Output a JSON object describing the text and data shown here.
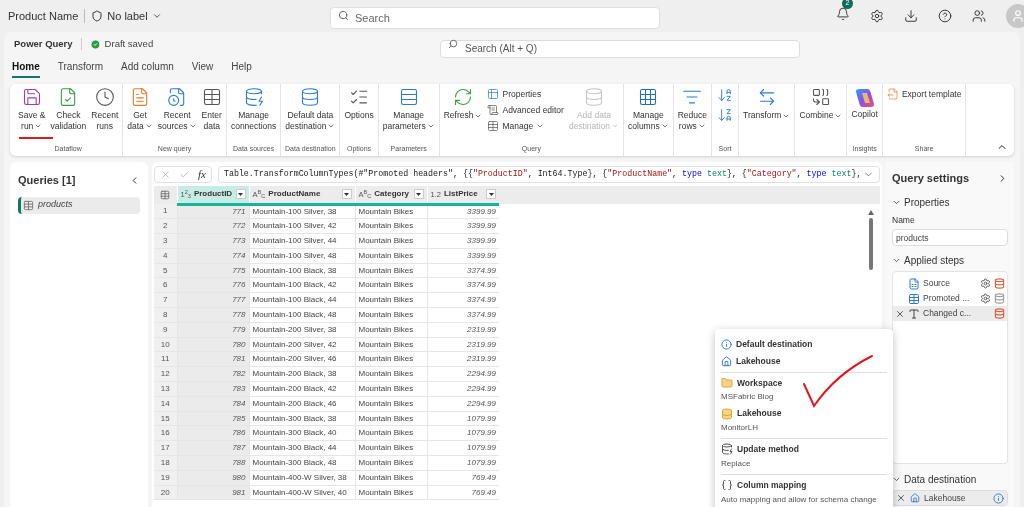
{
  "top_bar": {
    "title": "Product Name",
    "sensitivity": "No label",
    "search": {
      "placeholder": "Search"
    },
    "notification_count": "2"
  },
  "app_bar": {
    "app_name": "Power Query",
    "status": "Draft saved",
    "search": {
      "placeholder": "Search (Alt + Q)"
    }
  },
  "tabs": [
    {
      "label": "Home",
      "selected": true
    },
    {
      "label": "Transform",
      "selected": false
    },
    {
      "label": "Add column",
      "selected": false
    },
    {
      "label": "View",
      "selected": false
    },
    {
      "label": "Help",
      "selected": false
    }
  ],
  "ribbon": {
    "groups": [
      {
        "label": "Dataflow",
        "items": [
          {
            "kind": "large",
            "lines": [
              "Save &",
              "run"
            ],
            "dropdown": true,
            "disabled": false
          },
          {
            "kind": "large",
            "lines": [
              "Check",
              "validation"
            ],
            "dropdown": false,
            "disabled": false
          },
          {
            "kind": "large",
            "lines": [
              "Recent",
              "runs"
            ],
            "dropdown": false,
            "disabled": false
          }
        ]
      },
      {
        "label": "New query",
        "items": [
          {
            "kind": "large",
            "lines": [
              "Get",
              "data"
            ],
            "dropdown": true,
            "disabled": false
          },
          {
            "kind": "large",
            "lines": [
              "Recent",
              "sources"
            ],
            "dropdown": true,
            "disabled": false
          },
          {
            "kind": "large",
            "lines": [
              "Enter",
              "data"
            ],
            "dropdown": false,
            "disabled": false
          }
        ]
      },
      {
        "label": "Data sources",
        "items": [
          {
            "kind": "large",
            "lines": [
              "Manage",
              "connections"
            ],
            "dropdown": false,
            "disabled": false
          }
        ]
      },
      {
        "label": "Data destination",
        "items": [
          {
            "kind": "large",
            "lines": [
              "Default data",
              "destination"
            ],
            "dropdown": true,
            "disabled": false
          }
        ]
      },
      {
        "label": "Options",
        "items": [
          {
            "kind": "large",
            "lines": [
              "Options"
            ],
            "dropdown": false,
            "disabled": false
          }
        ]
      },
      {
        "label": "Parameters",
        "items": [
          {
            "kind": "large",
            "lines": [
              "Manage",
              "parameters"
            ],
            "dropdown": true,
            "disabled": false
          }
        ]
      },
      {
        "label": "Query",
        "items": [
          {
            "kind": "large",
            "lines": [
              "Refresh"
            ],
            "dropdown": true,
            "disabled": false
          },
          {
            "kind": "stack",
            "entries": [
              {
                "label": "Properties",
                "dropdown": false
              },
              {
                "label": "Advanced editor",
                "dropdown": false
              },
              {
                "label": "Manage",
                "dropdown": true
              }
            ]
          },
          {
            "kind": "large",
            "lines": [
              "Add data",
              "destination"
            ],
            "dropdown": true,
            "disabled": true
          }
        ]
      },
      {
        "items": [
          {
            "kind": "large",
            "lines": [
              "Manage",
              "columns"
            ],
            "dropdown": true,
            "disabled": false
          }
        ]
      },
      {
        "items": [
          {
            "kind": "large",
            "lines": [
              "Reduce",
              "rows"
            ],
            "dropdown": true,
            "disabled": false
          }
        ]
      },
      {
        "label": "Sort",
        "items": [
          {
            "kind": "sort-pair"
          }
        ]
      },
      {
        "items": [
          {
            "kind": "large",
            "lines": [
              "Transform"
            ],
            "dropdown": true,
            "disabled": false
          }
        ]
      },
      {
        "items": [
          {
            "kind": "large",
            "lines": [
              "Combine"
            ],
            "dropdown": true,
            "disabled": false
          }
        ]
      },
      {
        "label": "Insights",
        "items": [
          {
            "kind": "large",
            "lines": [
              "Copilot"
            ],
            "dropdown": false,
            "disabled": false
          }
        ]
      },
      {
        "label": "Share",
        "items": [
          {
            "kind": "stack",
            "entries": [
              {
                "label": "Export template",
                "dropdown": false
              }
            ]
          }
        ]
      }
    ]
  },
  "queries_pane": {
    "title": "Queries [1]",
    "items": [
      {
        "label": "products",
        "selected": true
      }
    ]
  },
  "formula_bar": {
    "tokens": [
      {
        "kind": "plain",
        "text": "Table.TransformColumnTypes(#\"Promoted headers\", {{"
      },
      {
        "kind": "string",
        "text": "\"ProductID\""
      },
      {
        "kind": "plain",
        "text": ", Int64.Type}, {"
      },
      {
        "kind": "string",
        "text": "\"ProductName\""
      },
      {
        "kind": "plain",
        "text": ", "
      },
      {
        "kind": "keyword",
        "text": "type"
      },
      {
        "kind": "typename",
        "text": " text"
      },
      {
        "kind": "plain",
        "text": "}, {"
      },
      {
        "kind": "string",
        "text": "\"Category\""
      },
      {
        "kind": "plain",
        "text": ", "
      },
      {
        "kind": "keyword",
        "text": "type"
      },
      {
        "kind": "typename",
        "text": " text"
      },
      {
        "kind": "plain",
        "text": "},"
      }
    ],
    "fx_label": "fx"
  },
  "table": {
    "columns": [
      {
        "type_icon": "1$^{2}$$_{3}$",
        "name": "ProductID",
        "selected": true
      },
      {
        "type_icon": "A$^{B}$$_{C}$",
        "name": "ProductName",
        "selected": false
      },
      {
        "type_icon": "A$^{B}$$_{C}$",
        "name": "Category",
        "selected": false
      },
      {
        "type_icon": "1.2",
        "name": "ListPrice",
        "selected": false
      }
    ],
    "rows": [
      {
        "number": "1",
        "cells": [
          "771",
          "Mountain-100 Silver, 38",
          "Mountain Bikes",
          "3399.99"
        ]
      },
      {
        "number": "2",
        "cells": [
          "772",
          "Mountain-100 Silver, 42",
          "Mountain Bikes",
          "3399.99"
        ]
      },
      {
        "number": "3",
        "cells": [
          "773",
          "Mountain-100 Silver, 44",
          "Mountain Bikes",
          "3399.99"
        ]
      },
      {
        "number": "4",
        "cells": [
          "774",
          "Mountain-100 Silver, 48",
          "Mountain Bikes",
          "3399.99"
        ]
      },
      {
        "number": "5",
        "cells": [
          "775",
          "Mountain-100 Black, 38",
          "Mountain Bikes",
          "3374.99"
        ]
      },
      {
        "number": "6",
        "cells": [
          "776",
          "Mountain-100 Black, 42",
          "Mountain Bikes",
          "3374.99"
        ]
      },
      {
        "number": "7",
        "cells": [
          "777",
          "Mountain-100 Black, 44",
          "Mountain Bikes",
          "3374.99"
        ]
      },
      {
        "number": "8",
        "cells": [
          "778",
          "Mountain-100 Black, 48",
          "Mountain Bikes",
          "3374.99"
        ]
      },
      {
        "number": "9",
        "cells": [
          "779",
          "Mountain-200 Silver, 38",
          "Mountain Bikes",
          "2319.99"
        ]
      },
      {
        "number": "10",
        "cells": [
          "780",
          "Mountain-200 Silver, 42",
          "Mountain Bikes",
          "2319.99"
        ]
      },
      {
        "number": "11",
        "cells": [
          "781",
          "Mountain-200 Silver, 46",
          "Mountain Bikes",
          "2319.99"
        ]
      },
      {
        "number": "12",
        "cells": [
          "782",
          "Mountain-200 Black, 38",
          "Mountain Bikes",
          "2294.99"
        ]
      },
      {
        "number": "13",
        "cells": [
          "783",
          "Mountain-200 Black, 42",
          "Mountain Bikes",
          "2294.99"
        ]
      },
      {
        "number": "14",
        "cells": [
          "784",
          "Mountain-200 Black, 46",
          "Mountain Bikes",
          "2294.99"
        ]
      },
      {
        "number": "15",
        "cells": [
          "785",
          "Mountain-300 Black, 38",
          "Mountain Bikes",
          "1079.99"
        ]
      },
      {
        "number": "16",
        "cells": [
          "786",
          "Mountain-300 Black, 40",
          "Mountain Bikes",
          "1079.99"
        ]
      },
      {
        "number": "17",
        "cells": [
          "787",
          "Mountain-300 Black, 44",
          "Mountain Bikes",
          "1079.99"
        ]
      },
      {
        "number": "18",
        "cells": [
          "788",
          "Mountain-300 Black, 48",
          "Mountain Bikes",
          "1079.99"
        ]
      },
      {
        "number": "19",
        "cells": [
          "980",
          "Mountain-400-W Silver, 38",
          "Mountain Bikes",
          "769.49"
        ]
      },
      {
        "number": "20",
        "cells": [
          "981",
          "Mountain-400-W Silver, 40",
          "Mountain Bikes",
          "769.49"
        ]
      }
    ]
  },
  "destination_flyout": {
    "sections": [
      {
        "items": [
          {
            "kind": "info",
            "title": "Default destination"
          },
          {
            "kind": "lakehouse",
            "title": "Lakehouse"
          }
        ]
      },
      {
        "items": [
          {
            "kind": "workspace",
            "title": "Workspace",
            "value": "MSFabric Blog"
          },
          {
            "kind": "database",
            "title": "Lakehouse",
            "value": "MonitorLH"
          }
        ]
      },
      {
        "items": [
          {
            "kind": "update",
            "title": "Update method",
            "value": "Replace"
          }
        ]
      },
      {
        "items": [
          {
            "kind": "mapping",
            "title": "Column mapping",
            "value": "Auto mapping and allow for schema change"
          }
        ]
      }
    ]
  },
  "query_settings": {
    "title": "Query settings",
    "properties": {
      "heading": "Properties",
      "expanded": true,
      "name_label": "Name",
      "name_value": "products"
    },
    "applied_steps": {
      "heading": "Applied steps",
      "expanded": true,
      "steps": [
        {
          "label": "Source",
          "selected": false,
          "settings": true,
          "color": "#d9603b"
        },
        {
          "label": "Promoted ...",
          "selected": false,
          "settings": true,
          "color": "#9e9e9e"
        },
        {
          "label": "Changed c...",
          "selected": true,
          "settings": false,
          "color": "#d9603b"
        }
      ]
    },
    "data_destination": {
      "heading": "Data destination",
      "expanded": true,
      "value": "Lakehouse"
    }
  }
}
